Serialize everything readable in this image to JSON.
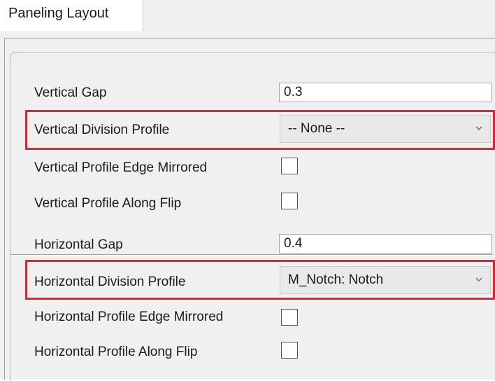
{
  "tabs": [
    {
      "label": "Paneling Layout"
    }
  ],
  "vertical": {
    "gap_label": "Vertical Gap",
    "gap_value": "0.3",
    "division_profile_label": "Vertical Division Profile",
    "division_profile_value": "-- None --",
    "edge_mirrored_label": "Vertical Profile Edge Mirrored",
    "edge_mirrored_checked": false,
    "along_flip_label": "Vertical Profile Along Flip",
    "along_flip_checked": false
  },
  "horizontal": {
    "gap_label": "Horizontal Gap",
    "gap_value": "0.4",
    "division_profile_label": "Horizontal Division Profile",
    "division_profile_value": "M_Notch: Notch",
    "edge_mirrored_label": "Horizontal Profile Edge Mirrored",
    "edge_mirrored_checked": false,
    "along_flip_label": "Horizontal Profile Along Flip",
    "along_flip_checked": false
  },
  "colors": {
    "highlight": "#e8202a",
    "panel_background": "#f0f0f0",
    "combo_background": "#e9e9e9"
  },
  "icons": {
    "dropdown": "chevron-down-icon"
  }
}
